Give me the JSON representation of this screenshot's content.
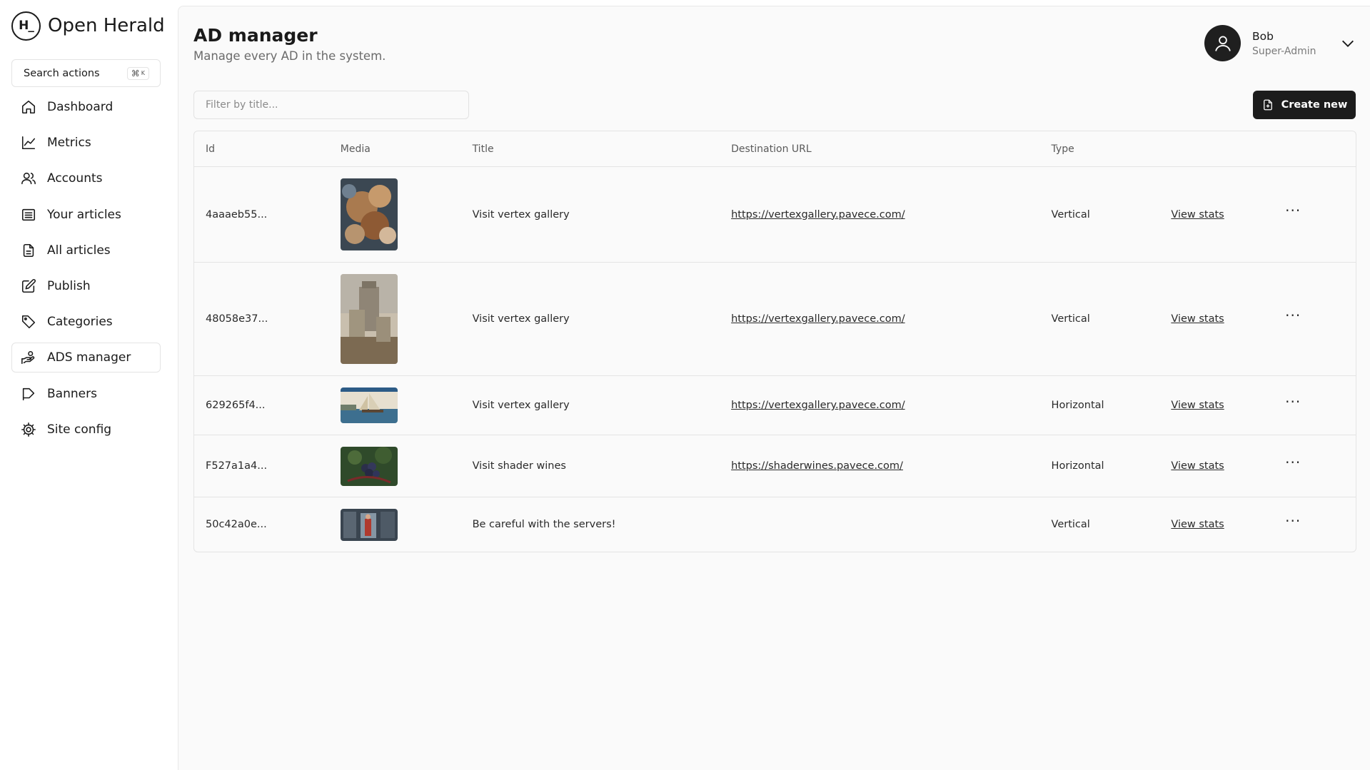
{
  "brand": {
    "mark": "H_",
    "name": "Open Herald"
  },
  "search": {
    "label": "Search actions",
    "shortcut_symbol": "⌘",
    "shortcut_key": "K"
  },
  "nav": [
    {
      "label": "Dashboard",
      "icon": "home-icon"
    },
    {
      "label": "Metrics",
      "icon": "chart-line-icon"
    },
    {
      "label": "Accounts",
      "icon": "users-icon"
    },
    {
      "label": "Your articles",
      "icon": "list-icon"
    },
    {
      "label": "All articles",
      "icon": "files-icon"
    },
    {
      "label": "Publish",
      "icon": "edit-icon"
    },
    {
      "label": "Categories",
      "icon": "tag-icon"
    },
    {
      "label": "ADS manager",
      "icon": "hand-coin-icon",
      "active": true
    },
    {
      "label": "Banners",
      "icon": "flag-icon"
    },
    {
      "label": "Site config",
      "icon": "gear-icon"
    }
  ],
  "header": {
    "title": "AD manager",
    "subtitle": "Manage every AD in the system."
  },
  "user": {
    "name": "Bob",
    "role": "Super-Admin"
  },
  "filter": {
    "placeholder": "Filter by title..."
  },
  "toolbar": {
    "create_label": "Create new"
  },
  "table": {
    "columns": [
      "Id",
      "Media",
      "Title",
      "Destination URL",
      "Type",
      "",
      ""
    ],
    "rows": [
      {
        "id": "4aaaeb55...",
        "title": "Visit vertex gallery",
        "url": "https://vertexgallery.pavece.com/",
        "type": "Vertical",
        "stats": "View stats",
        "more": "···"
      },
      {
        "id": "48058e37...",
        "title": "Visit vertex gallery",
        "url": "https://vertexgallery.pavece.com/",
        "type": "Vertical",
        "stats": "View stats",
        "more": "···"
      },
      {
        "id": "629265f4...",
        "title": "Visit vertex gallery",
        "url": "https://vertexgallery.pavece.com/",
        "type": "Horizontal",
        "stats": "View stats",
        "more": "···"
      },
      {
        "id": "F527a1a4...",
        "title": "Visit shader wines",
        "url": "https://shaderwines.pavece.com/",
        "type": "Horizontal",
        "stats": "View stats",
        "more": "···"
      },
      {
        "id": "50c42a0e...",
        "title": "Be careful with the servers!",
        "url": "",
        "type": "Vertical",
        "stats": "View stats",
        "more": "···"
      }
    ]
  }
}
